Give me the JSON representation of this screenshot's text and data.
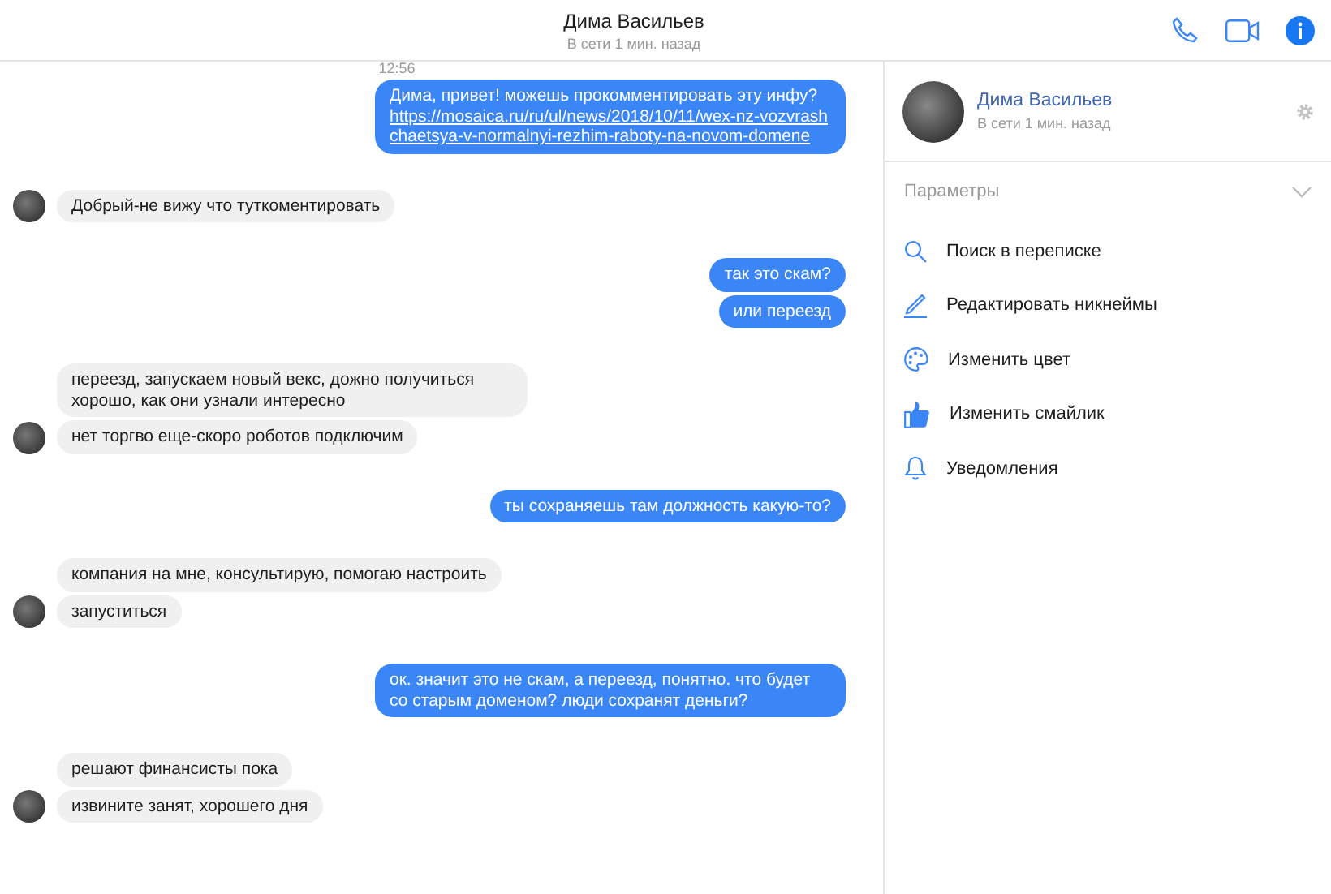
{
  "header": {
    "name": "Дима Васильев",
    "status": "В сети 1 мин. назад"
  },
  "chat": {
    "time": "12:56",
    "groups": [
      {
        "kind": "outgoing",
        "bubbles": [
          {
            "text": "Дима, привет! можешь прокомментировать эту инфу? ",
            "link": "https://mosaica.ru/ru/ul/news/2018/10/11/wex-nz-vozvrashchaetsya-v-normalnyi-rezhim-raboty-na-novom-domene"
          }
        ]
      },
      {
        "kind": "incoming",
        "bubbles": [
          {
            "text": "Добрый-не вижу что туткоментировать"
          }
        ]
      },
      {
        "kind": "outgoing",
        "bubbles": [
          {
            "text": "так это скам?"
          },
          {
            "text": "или переезд"
          }
        ]
      },
      {
        "kind": "incoming",
        "bubbles": [
          {
            "text": "переезд, запускаем новый векс, дожно получиться хорошо, как они узнали интересно"
          },
          {
            "text": "нет торгво еще-скоро роботов подключим"
          }
        ]
      },
      {
        "kind": "outgoing",
        "bubbles": [
          {
            "text": "ты сохраняешь там должность какую-то?"
          }
        ]
      },
      {
        "kind": "incoming",
        "bubbles": [
          {
            "text": "компания на мне, консультирую, помогаю настроить"
          },
          {
            "text": "запуститься"
          }
        ]
      },
      {
        "kind": "outgoing",
        "bubbles": [
          {
            "text": "ок. значит это не скам, а переезд, понятно. что будет со старым доменом? люди сохранят деньги?"
          }
        ]
      },
      {
        "kind": "incoming",
        "bubbles": [
          {
            "text": "решают финансисты пока"
          },
          {
            "text": "извините занят, хорошего дня"
          }
        ]
      }
    ]
  },
  "panel": {
    "name": "Дима Васильев",
    "status": "В сети 1 мин. назад",
    "section": "Параметры",
    "items": [
      {
        "kind": "search",
        "label": "Поиск в переписке"
      },
      {
        "kind": "pencil",
        "label": "Редактировать никнеймы"
      },
      {
        "kind": "palette",
        "label": "Изменить цвет"
      },
      {
        "kind": "thumb",
        "label": "Изменить смайлик"
      },
      {
        "kind": "bell",
        "label": "Уведомления"
      }
    ]
  }
}
